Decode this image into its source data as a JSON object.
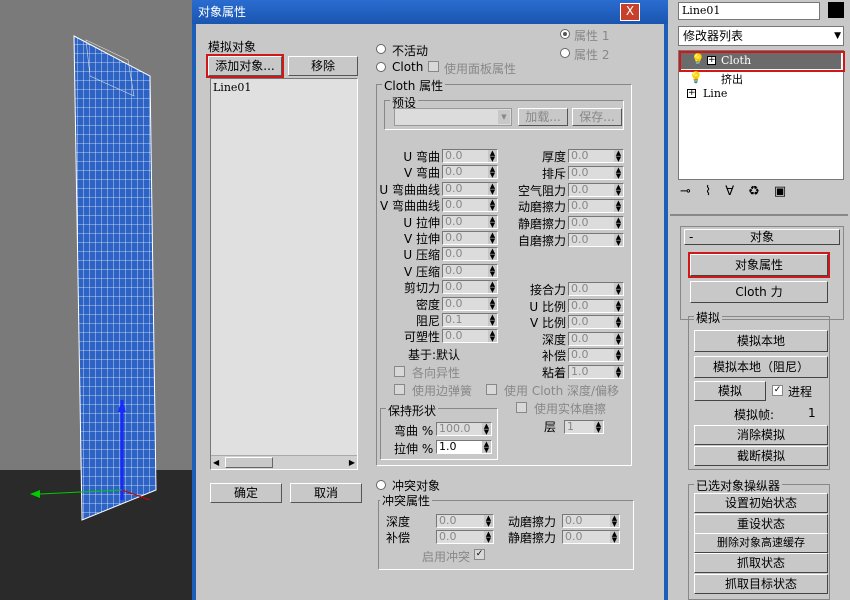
{
  "dialog": {
    "title": "对象属性",
    "close": "X",
    "sim_objects_label": "模拟对象",
    "add_object": "添加对象...",
    "remove": "移除",
    "object_list": [
      "Line01"
    ],
    "ok": "确定",
    "cancel": "取消",
    "inactive": "不活动",
    "cloth": "Cloth",
    "use_panel_props": "使用面板属性",
    "prop1": "属性 1",
    "prop2": "属性 2",
    "cloth_props": "Cloth 属性",
    "preset": "预设",
    "load": "加载...",
    "save": "保存...",
    "left_params": [
      {
        "label": "U 弯曲",
        "value": "0.0"
      },
      {
        "label": "V 弯曲",
        "value": "0.0"
      },
      {
        "label": "U 弯曲曲线",
        "value": "0.0"
      },
      {
        "label": "V 弯曲曲线",
        "value": "0.0"
      },
      {
        "label": "U 拉伸",
        "value": "0.0"
      },
      {
        "label": "V 拉伸",
        "value": "0.0"
      },
      {
        "label": "U 压缩",
        "value": "0.0"
      },
      {
        "label": "V 压缩",
        "value": "0.0"
      },
      {
        "label": "剪切力",
        "value": "0.0"
      },
      {
        "label": "密度",
        "value": "0.0"
      },
      {
        "label": "阻尼",
        "value": "0.1"
      },
      {
        "label": "可塑性",
        "value": "0.0"
      }
    ],
    "right_params_top": [
      {
        "label": "厚度",
        "value": "0.0"
      },
      {
        "label": "排斥",
        "value": "0.0"
      },
      {
        "label": "空气阻力",
        "value": "0.0"
      },
      {
        "label": "动磨擦力",
        "value": "0.0"
      },
      {
        "label": "静磨擦力",
        "value": "0.0"
      },
      {
        "label": "自磨擦力",
        "value": "0.0"
      }
    ],
    "right_params_bottom": [
      {
        "label": "接合力",
        "value": "0.0"
      },
      {
        "label": "U 比例",
        "value": "0.0"
      },
      {
        "label": "V 比例",
        "value": "0.0"
      },
      {
        "label": "深度",
        "value": "0.0"
      },
      {
        "label": "补偿",
        "value": "0.0"
      },
      {
        "label": "粘着",
        "value": "1.0"
      }
    ],
    "based_on": "基于:默认",
    "anisotropic": "各向异性",
    "use_edge_springs": "使用边弹簧",
    "use_cloth_depth": "使用 Cloth 深度/偏移",
    "use_solid_friction": "使用实体磨擦",
    "keep_shape": "保持形状",
    "bend_pct": "弯曲 %",
    "bend_val": "100.0",
    "stretch_pct": "拉伸 %",
    "stretch_val": "1.0",
    "layer": "层",
    "layer_val": "1",
    "collision_object": "冲突对象",
    "collision_props": "冲突属性",
    "c_depth": "深度",
    "c_depth_val": "0.0",
    "c_offset": "补偿",
    "c_offset_val": "0.0",
    "c_dyn_friction": "动磨擦力",
    "c_dyn_val": "0.0",
    "c_static_friction": "静磨擦力",
    "c_static_val": "0.0",
    "enable_collision": "启用冲突"
  },
  "rpanel": {
    "object_name": "Line01",
    "modifier_list": "修改器列表",
    "stack": [
      "Cloth",
      "挤出",
      "Line"
    ],
    "section_object": "对象",
    "object_props": "对象属性",
    "cloth_forces": "Cloth 力",
    "simulation": "模拟",
    "sim_local": "模拟本地",
    "sim_local_damped": "模拟本地（阻尼）",
    "simulate": "模拟",
    "progress": "进程",
    "sim_frame": "模拟帧:",
    "sim_frame_val": "1",
    "erase_sim": "消除模拟",
    "truncate_sim": "截断模拟",
    "selected_ops": "已选对象操纵器",
    "set_init_state": "设置初始状态",
    "reset_state": "重设状态",
    "delete_cache": "删除对象高速缓存",
    "grab_state": "抓取状态",
    "grab_target": "抓取目标状态"
  }
}
